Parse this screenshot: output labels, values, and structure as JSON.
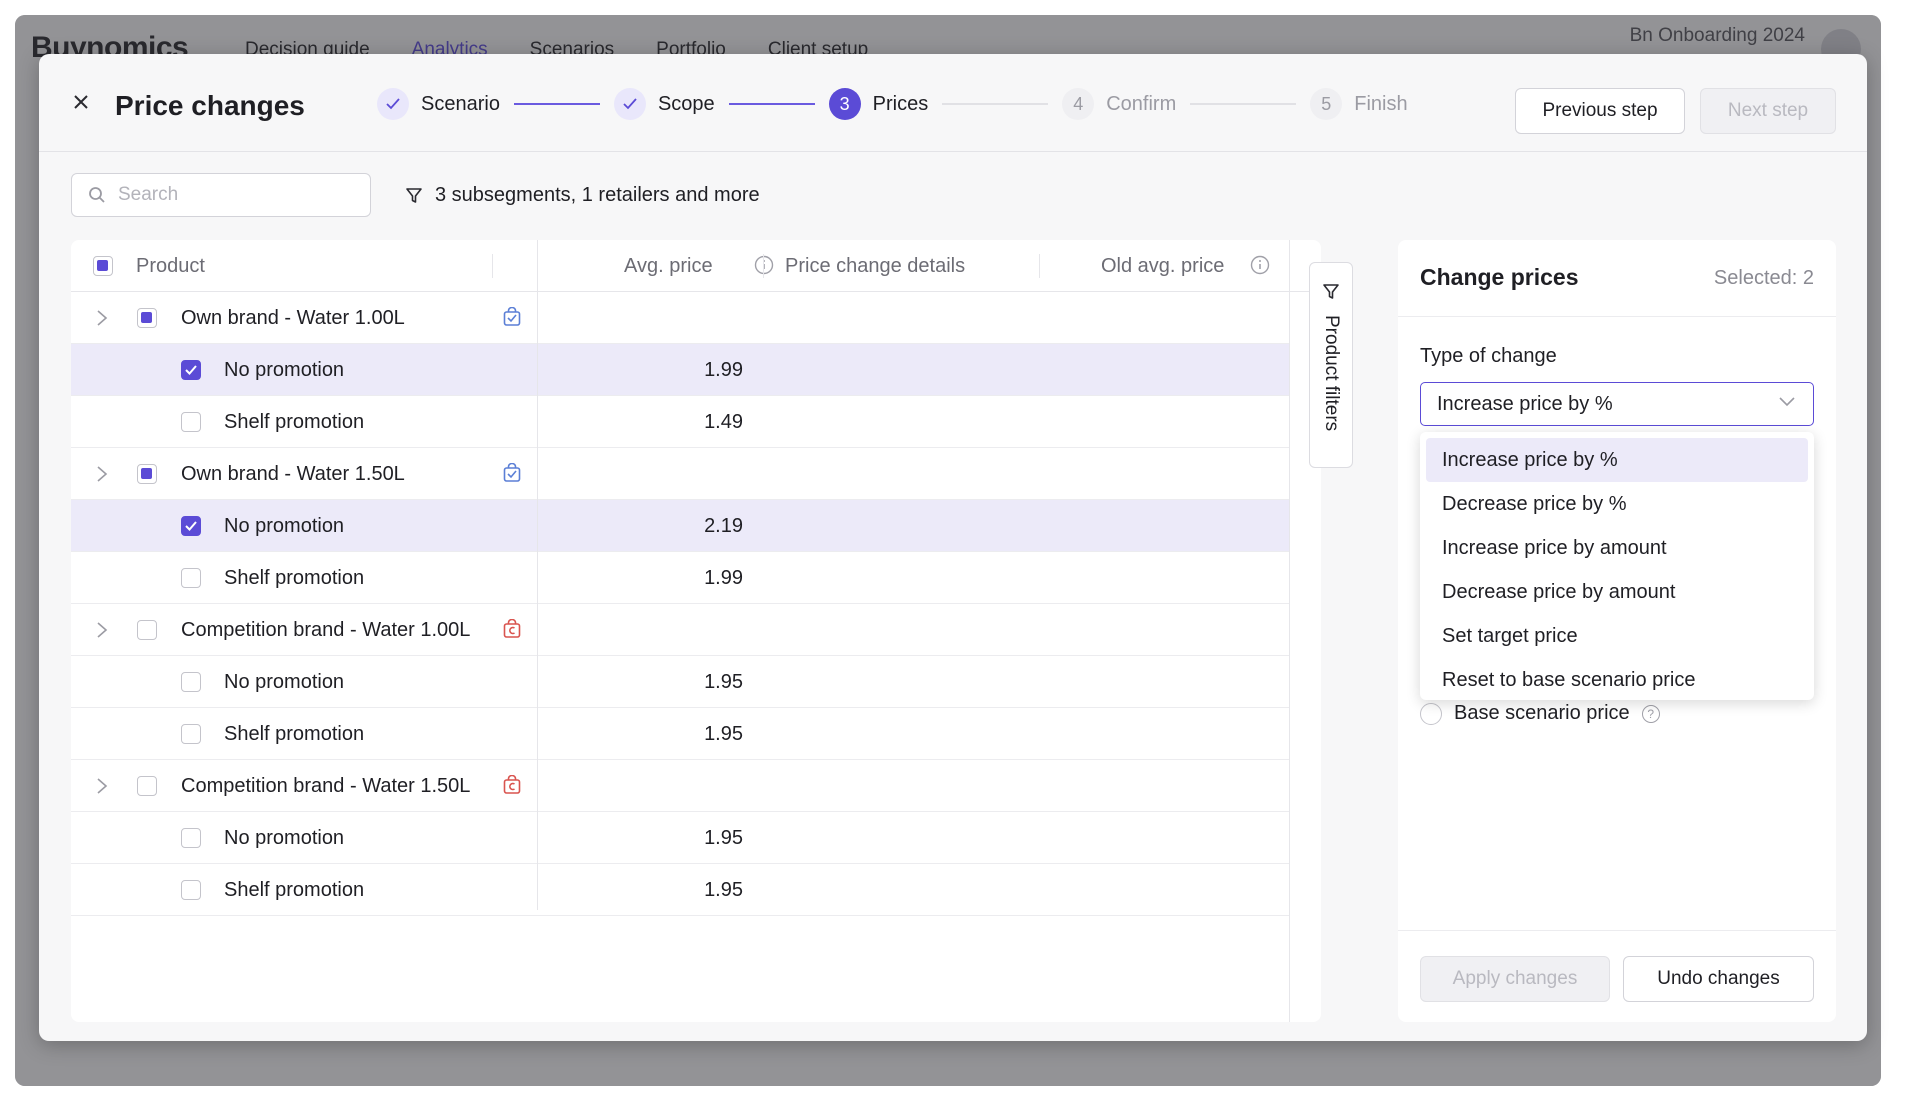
{
  "background": {
    "logo": "Buynomics",
    "nav": [
      "Decision guide",
      "Analytics",
      "Scenarios",
      "Portfolio",
      "Client setup"
    ],
    "active_nav": "Analytics",
    "workspace": "Bn Onboarding 2024"
  },
  "modal": {
    "title": "Price changes",
    "steps": [
      {
        "num": "1",
        "label": "Scenario",
        "state": "done"
      },
      {
        "num": "2",
        "label": "Scope",
        "state": "done"
      },
      {
        "num": "3",
        "label": "Prices",
        "state": "current"
      },
      {
        "num": "4",
        "label": "Confirm",
        "state": "future"
      },
      {
        "num": "5",
        "label": "Finish",
        "state": "future"
      }
    ],
    "prev_label": "Previous step",
    "next_label": "Next step"
  },
  "search": {
    "placeholder": "Search",
    "value": ""
  },
  "filter_summary": "3 subsegments, 1 retailers and more",
  "table": {
    "headers": {
      "product": "Product",
      "avg_price": "Avg. price",
      "details": "Price change details",
      "old_price": "Old avg. price"
    },
    "rows": [
      {
        "type": "group",
        "name": "Own brand - Water 1.00L",
        "check": "ind",
        "brand": "own"
      },
      {
        "type": "item",
        "name": "No promotion",
        "price": "1.99",
        "check": "chk",
        "selected": true
      },
      {
        "type": "item",
        "name": "Shelf promotion",
        "price": "1.49",
        "check": "none",
        "selected": false
      },
      {
        "type": "group",
        "name": "Own brand - Water 1.50L",
        "check": "ind",
        "brand": "own"
      },
      {
        "type": "item",
        "name": "No promotion",
        "price": "2.19",
        "check": "chk",
        "selected": true
      },
      {
        "type": "item",
        "name": "Shelf promotion",
        "price": "1.99",
        "check": "none",
        "selected": false
      },
      {
        "type": "group",
        "name": "Competition brand - Water 1.00L",
        "check": "none",
        "brand": "comp"
      },
      {
        "type": "item",
        "name": "No promotion",
        "price": "1.95",
        "check": "none",
        "selected": false
      },
      {
        "type": "item",
        "name": "Shelf promotion",
        "price": "1.95",
        "check": "none",
        "selected": false
      },
      {
        "type": "group",
        "name": "Competition brand - Water 1.50L",
        "check": "none",
        "brand": "comp"
      },
      {
        "type": "item",
        "name": "No promotion",
        "price": "1.95",
        "check": "none",
        "selected": false
      },
      {
        "type": "item",
        "name": "Shelf promotion",
        "price": "1.95",
        "check": "none",
        "selected": false
      }
    ]
  },
  "product_filters_label": "Product filters",
  "panel": {
    "title": "Change prices",
    "selected": "Selected: 2",
    "type_label": "Type of change",
    "type_value": "Increase price by %",
    "options": [
      "Increase price by %",
      "Decrease price by %",
      "Increase price by amount",
      "Decrease price by amount",
      "Set target price",
      "Reset to base scenario price"
    ],
    "radio_label": "Base scenario price",
    "apply_label": "Apply changes",
    "undo_label": "Undo changes"
  },
  "colors": {
    "accent": "#5b4bd6",
    "own_brand": "#5b7fd6",
    "competition": "#d9544f"
  }
}
